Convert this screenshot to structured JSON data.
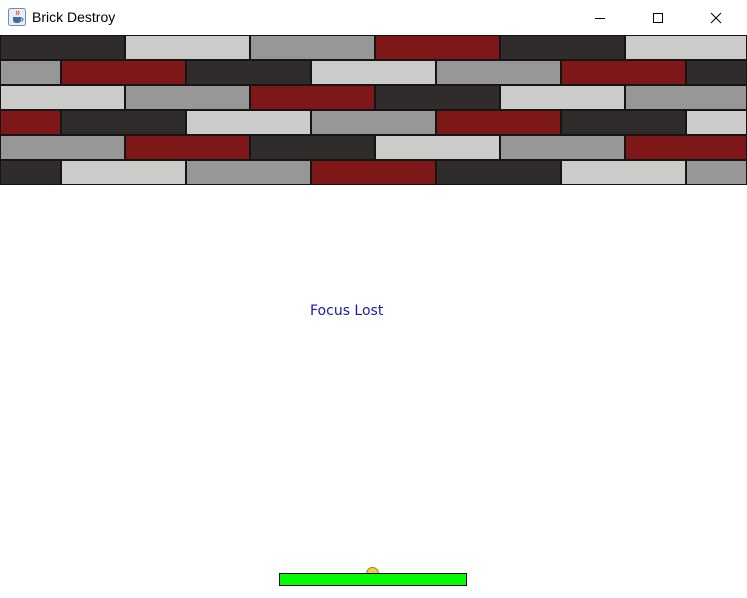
{
  "window": {
    "title": "Brick Destroy",
    "icon": "java-cup-icon",
    "controls": [
      "minimize-icon",
      "maximize-icon",
      "close-icon"
    ]
  },
  "colors": {
    "dark": "#302c2b",
    "light": "#cbcbc9",
    "gray": "#979797",
    "red": "#7e1818",
    "paddle": "#00ff00",
    "ball": "#f6c84c",
    "message": "#1a1aa8"
  },
  "game": {
    "message": "Focus Lost",
    "bricks": [
      [
        "dark",
        "light",
        "gray",
        "red",
        "dark",
        "light"
      ],
      [
        "gray",
        "red",
        "dark",
        "light",
        "gray",
        "red",
        "dark"
      ],
      [
        "light",
        "gray",
        "red",
        "dark",
        "light",
        "gray"
      ],
      [
        "red",
        "dark",
        "light",
        "gray",
        "red",
        "dark",
        "light"
      ],
      [
        "gray",
        "red",
        "dark",
        "light",
        "gray",
        "red"
      ],
      [
        "dark",
        "light",
        "gray",
        "red",
        "dark",
        "light",
        "gray"
      ]
    ]
  }
}
